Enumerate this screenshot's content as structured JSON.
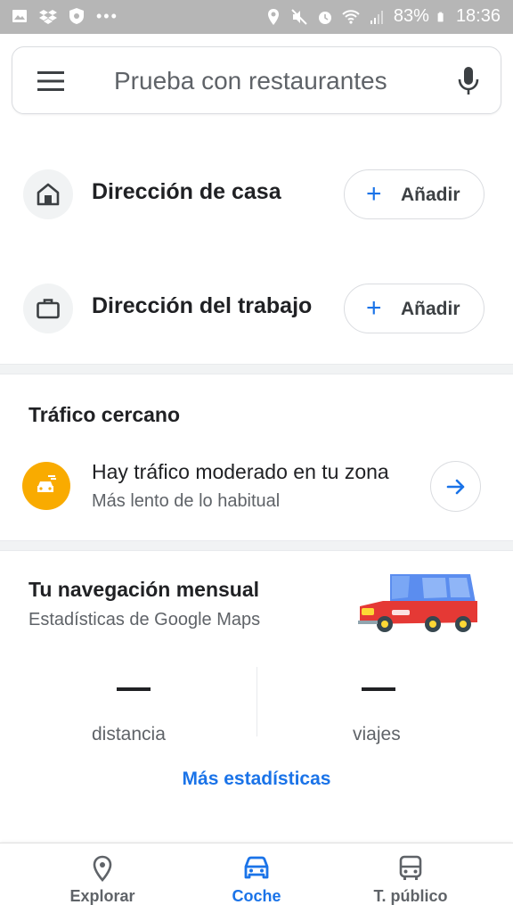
{
  "status_bar": {
    "battery": "83%",
    "time": "18:36",
    "left_icons": [
      "gallery-icon",
      "dropbox-icon",
      "shield-icon",
      "more-dots-icon"
    ],
    "right_icons": [
      "location-icon",
      "mute-icon",
      "alarm-icon",
      "wifi-icon",
      "signal-icon",
      "battery-icon"
    ]
  },
  "search": {
    "placeholder": "Prueba con restaurantes",
    "left_icon": "menu-icon",
    "right_icon": "mic-icon"
  },
  "addresses": [
    {
      "label": "Dirección de casa",
      "icon": "home-icon",
      "button": "Añadir"
    },
    {
      "label": "Dirección del trabajo",
      "icon": "briefcase-icon",
      "button": "Añadir"
    }
  ],
  "traffic": {
    "title": "Tráfico cercano",
    "main": "Hay tráfico moderado en tu zona",
    "sub": "Más lento de lo habitual",
    "icon": "traffic-car-icon"
  },
  "monthly": {
    "title": "Tu navegación mensual",
    "subtitle": "Estadísticas de Google Maps",
    "stats": [
      {
        "value": "—",
        "label": "distancia"
      },
      {
        "value": "—",
        "label": "viajes"
      }
    ],
    "more": "Más estadísticas"
  },
  "bottom_nav": [
    {
      "label": "Explorar",
      "icon": "location-pin-icon",
      "active": false
    },
    {
      "label": "Coche",
      "icon": "car-icon",
      "active": true
    },
    {
      "label": "T. público",
      "icon": "bus-icon",
      "active": false
    }
  ],
  "colors": {
    "accent": "#1a73e8",
    "traffic_badge": "#f9ab00",
    "status_bar": "#b6b6b6"
  }
}
